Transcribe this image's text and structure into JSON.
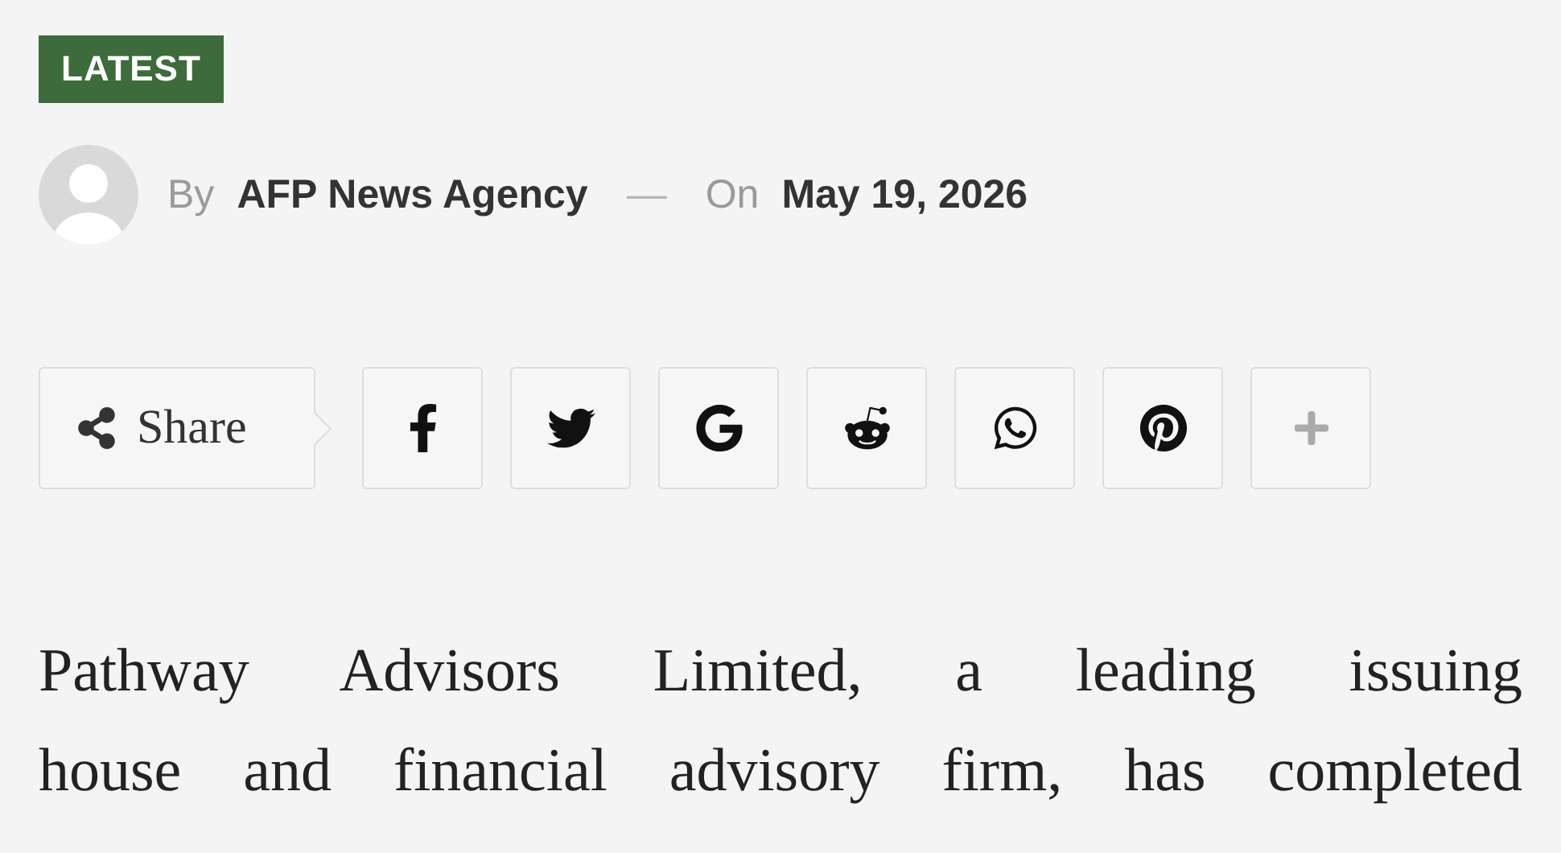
{
  "badge": "LATEST",
  "byline": {
    "by_label": "By",
    "author": "AFP News Agency",
    "separator": "—",
    "on_label": "On",
    "date": "May 19, 2026"
  },
  "share": {
    "label": "Share",
    "buttons": [
      {
        "kind": "facebook"
      },
      {
        "kind": "twitter"
      },
      {
        "kind": "google"
      },
      {
        "kind": "reddit"
      },
      {
        "kind": "whatsapp"
      },
      {
        "kind": "pinterest"
      },
      {
        "kind": "more"
      }
    ]
  },
  "body_lines": [
    "Pathway Advisors Limited, a leading issuing",
    "house and financial advisory firm, has completed"
  ]
}
